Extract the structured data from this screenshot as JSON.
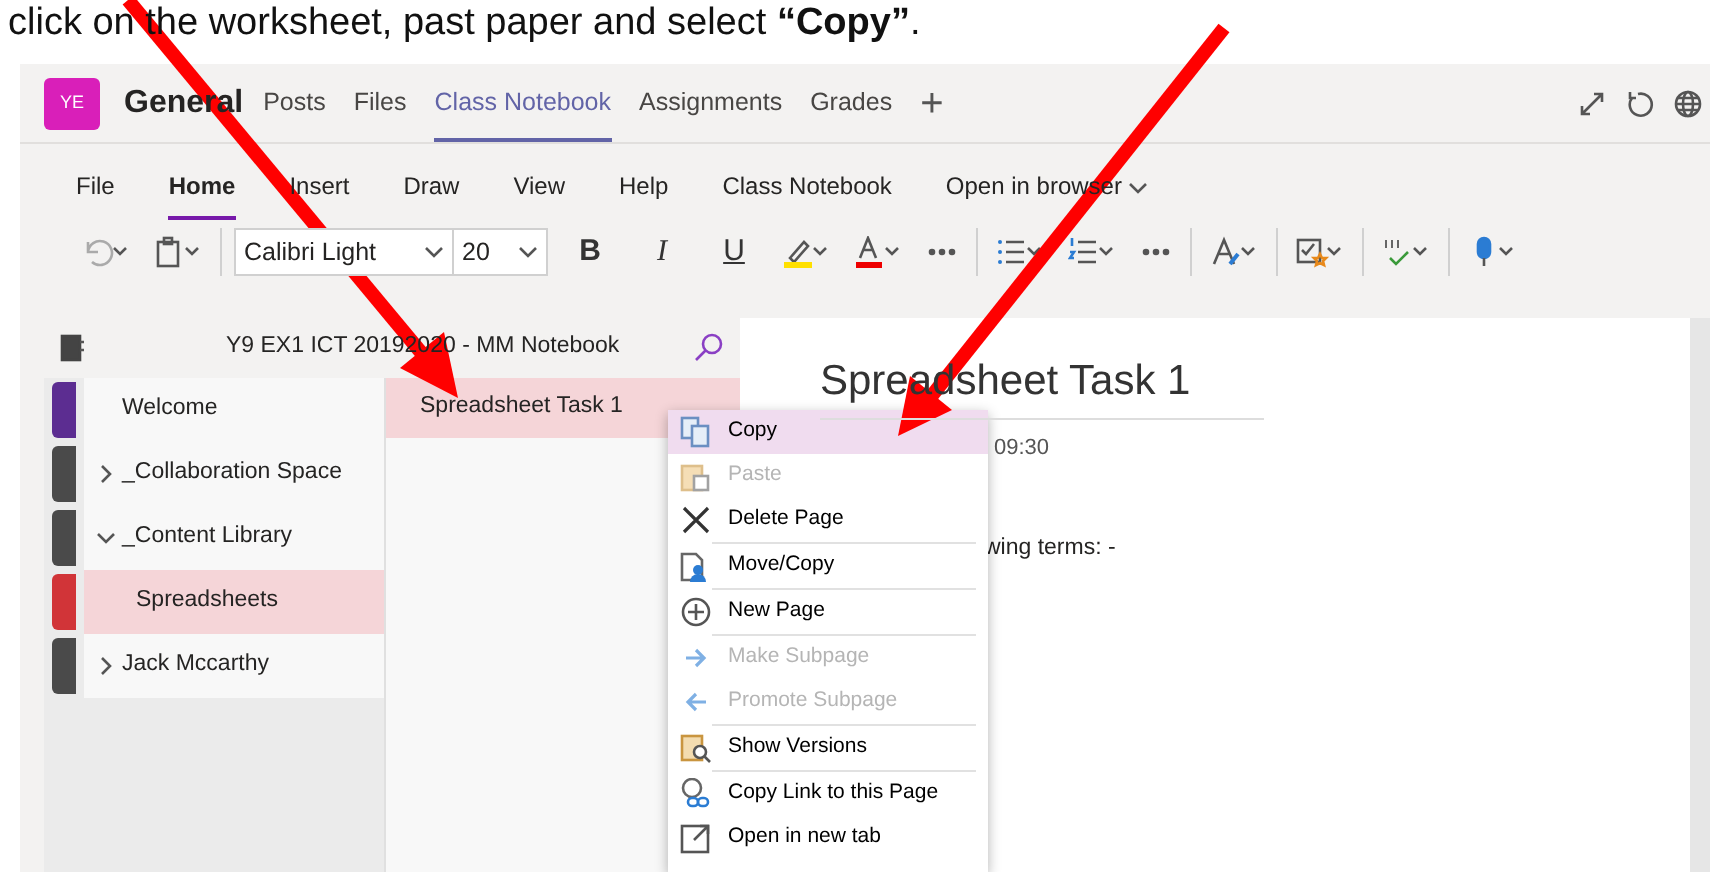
{
  "caption": {
    "text": "click on the worksheet, past paper and select **“Copy”**."
  },
  "header": {
    "avatar": "YE",
    "channel": "General",
    "add": "+",
    "tabs": [
      {
        "label": "Posts",
        "selected": false
      },
      {
        "label": "Files",
        "selected": false
      },
      {
        "label": "Class Notebook",
        "selected": true
      },
      {
        "label": "Assignments",
        "selected": false
      },
      {
        "label": "Grades",
        "selected": false
      }
    ]
  },
  "ribbon": {
    "tabs": [
      {
        "label": "File",
        "selected": false
      },
      {
        "label": "Home",
        "selected": true
      },
      {
        "label": "Insert",
        "selected": false
      },
      {
        "label": "Draw",
        "selected": false
      },
      {
        "label": "View",
        "selected": false
      },
      {
        "label": "Help",
        "selected": false
      },
      {
        "label": "Class Notebook",
        "selected": false
      },
      {
        "label": "Open in browser",
        "selected": false
      }
    ],
    "font": "Calibri Light",
    "font_size": "20",
    "format_buttons": [
      "B",
      "I",
      "U"
    ]
  },
  "notebook": {
    "title": "Y9 EX1 ICT 20192020 - MM Notebook",
    "sections": [
      {
        "label": "Welcome",
        "color": "#5c2d91",
        "selected": false
      },
      {
        "label": "_Collaboration Space",
        "color": "#4a4a4a",
        "selected": false,
        "expanded": false
      },
      {
        "label": "_Content Library",
        "color": "#4a4a4a",
        "selected": false,
        "expanded": true,
        "children": [
          {
            "label": "Spreadsheets",
            "color": "#d13438",
            "selected": true
          }
        ]
      },
      {
        "label": "Jack Mccarthy",
        "color": "#4a4a4a",
        "selected": false,
        "expanded": false
      }
    ],
    "pages": [
      {
        "label": "Spreadsheet Task 1",
        "selected": true
      }
    ]
  },
  "page": {
    "title": "Spreadsheet Task 1",
    "time": "09:30",
    "body": "wing terms: -"
  },
  "context_menu": [
    {
      "label": "Copy",
      "selected": true,
      "disabled": false,
      "divider_after": false
    },
    {
      "label": "Paste",
      "selected": false,
      "disabled": true,
      "divider_after": false
    },
    {
      "label": "Delete Page",
      "selected": false,
      "disabled": false,
      "divider_after": true
    },
    {
      "label": "Move/Copy",
      "selected": false,
      "disabled": false,
      "divider_after": true
    },
    {
      "label": "New Page",
      "selected": false,
      "disabled": false,
      "divider_after": true
    },
    {
      "label": "Make Subpage",
      "selected": false,
      "disabled": true,
      "divider_after": false
    },
    {
      "label": "Promote Subpage",
      "selected": false,
      "disabled": true,
      "divider_after": true
    },
    {
      "label": "Show Versions",
      "selected": false,
      "disabled": false,
      "divider_after": true
    },
    {
      "label": "Copy Link to this Page",
      "selected": false,
      "disabled": false,
      "divider_after": false
    },
    {
      "label": "Open in new tab",
      "selected": false,
      "disabled": false,
      "divider_after": false
    }
  ]
}
